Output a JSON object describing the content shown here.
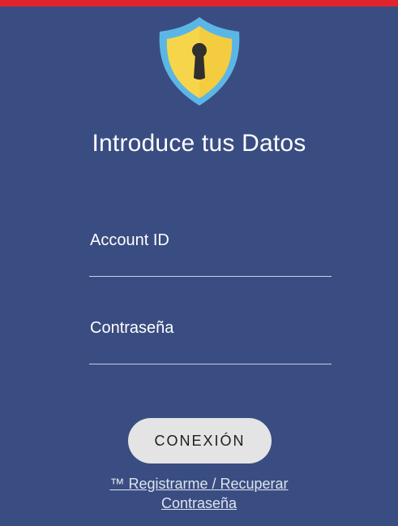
{
  "header": {
    "accent_color": "#e0242e"
  },
  "logo": {
    "icon": "shield-keyhole-icon",
    "colors": {
      "outer": "#5bb6e6",
      "inner": "#f7d54a",
      "keyhole": "#2f2f2f"
    }
  },
  "title": "Introduce tus Datos",
  "form": {
    "account_id": {
      "label": "Account ID",
      "value": ""
    },
    "password": {
      "label": "Contraseña",
      "value": ""
    }
  },
  "connect_button": {
    "label": "CONEXIÓN"
  },
  "register_link": {
    "line1": "™ Registrarme / Recuperar",
    "line2": "Contraseña"
  },
  "colors": {
    "background": "#3a4d82",
    "button": "#e4e4e4",
    "text": "#ffffff"
  }
}
